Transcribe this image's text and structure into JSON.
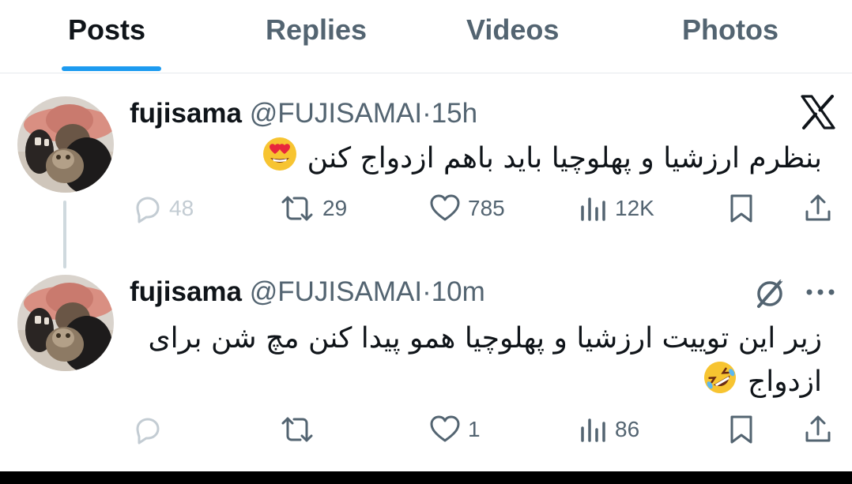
{
  "tabs": [
    {
      "label": "Posts",
      "active": true
    },
    {
      "label": "Replies",
      "active": false
    },
    {
      "label": "Videos",
      "active": false
    },
    {
      "label": "Photos",
      "active": false
    }
  ],
  "tweets": [
    {
      "name": "fujisama",
      "handle": "@FUJISAMAI",
      "separator": "·",
      "time": "15h",
      "text": "بنظرم ارزشیا و پهلوچیا باید باهم ازدواج کنن",
      "emoji": "heart-eyes-emoji",
      "corner_icon": "x-logo-icon",
      "replies": "48",
      "reposts": "29",
      "likes": "785",
      "views": "12K"
    },
    {
      "name": "fujisama",
      "handle": "@FUJISAMAI",
      "separator": "·",
      "time": "10m",
      "text_line1": "زیر این توییت ارزشیا و پهلوچیا همو پیدا کنن مچ شن برای",
      "text_line2": "ازدواج",
      "emoji": "rofl-emoji",
      "corner_icon": "grok-icon",
      "more_icon": "more-icon",
      "replies": "",
      "reposts": "",
      "likes": "1",
      "views": "86"
    }
  ],
  "colors": {
    "accent": "#1d9bf0",
    "text": "#0f1419",
    "muted": "#536471",
    "faint": "#c3ccd3"
  }
}
